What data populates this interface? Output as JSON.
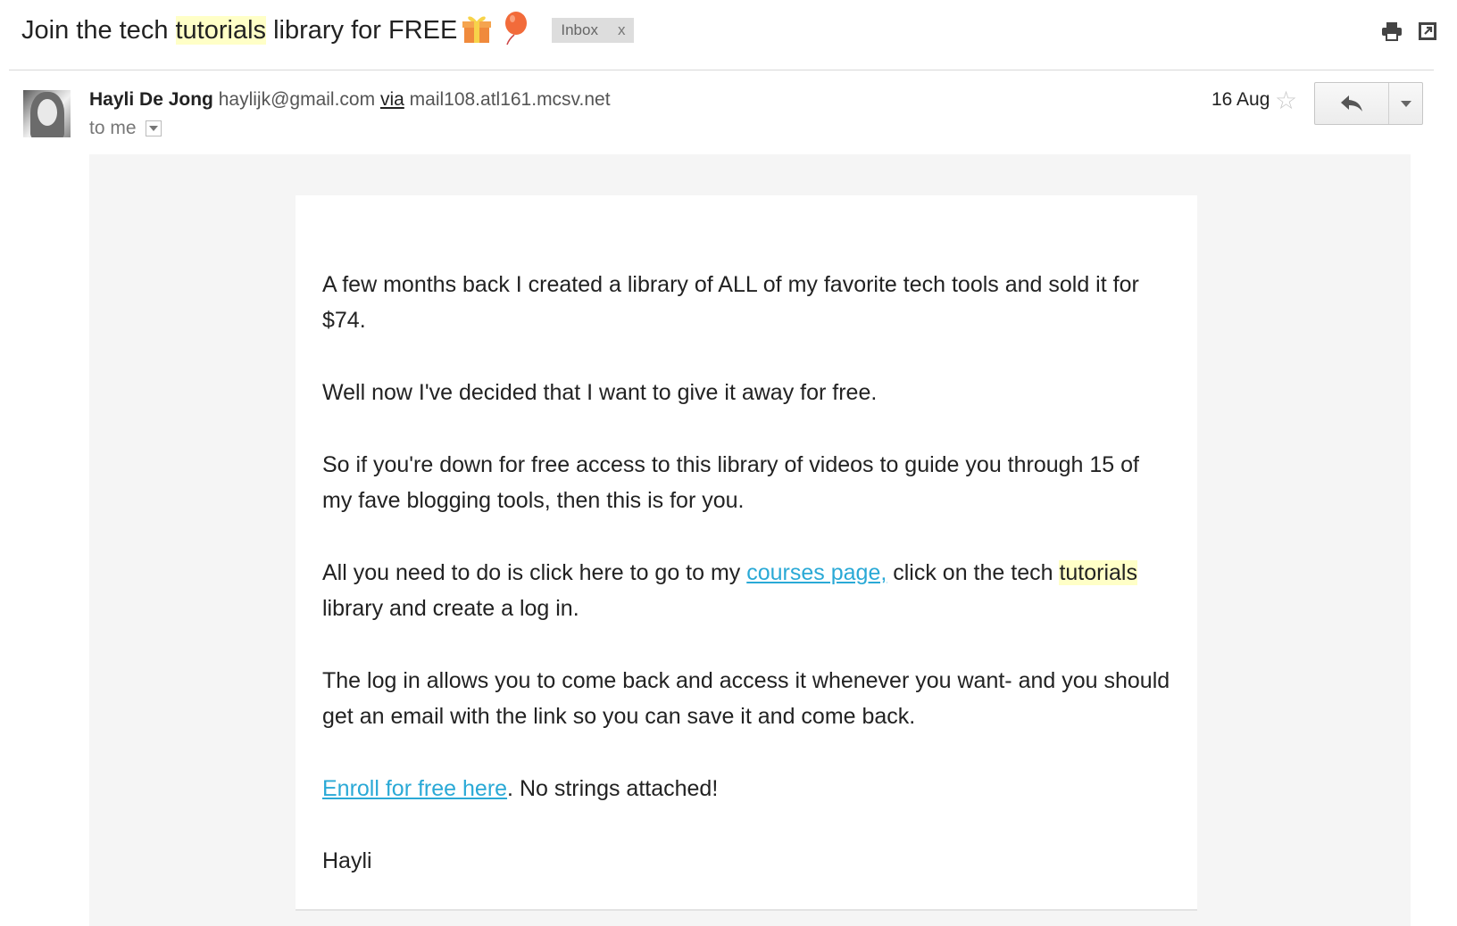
{
  "subject": {
    "before": "Join the tech ",
    "highlight": "tutorials",
    "after": " library for FREE",
    "emoji_icons": [
      "gift-icon",
      "balloon-icon"
    ],
    "label": "Inbox",
    "label_remove": "x"
  },
  "toolbar": {
    "icons": [
      "print-icon",
      "open-in-new-window-icon"
    ]
  },
  "sender": {
    "name": "Hayli De Jong",
    "email": "haylijk@gmail.com",
    "via_label": "via",
    "via_server": "mail108.atl161.mcsv.net",
    "to": "to me",
    "date": "16 Aug"
  },
  "message": {
    "p1": "A few months back I created a library of ALL of my favorite tech tools and sold it for $74.",
    "p2": "Well now I've decided that I want to give it away for free.",
    "p3": "So if you're down for free access to this library of videos to guide you through 15 of my fave blogging tools, then this is for you.",
    "p4_before": "All you need to do is click here to go to my ",
    "p4_link": "courses page,",
    "p4_mid": " click on the tech ",
    "p4_highlight": "tutorials",
    "p4_after": " library and create a log in.",
    "p5": "The log in allows you to come back and access it whenever you want- and you should get an email with the link so you can save it and come back.",
    "p6_link": "Enroll for free here",
    "p6_after": ". No strings attached!",
    "signature": "Hayli"
  },
  "colors": {
    "link": "#2aa9d6",
    "highlight": "#ffffc7",
    "label_bg": "#dddddd",
    "body_bg": "#f5f5f5"
  }
}
